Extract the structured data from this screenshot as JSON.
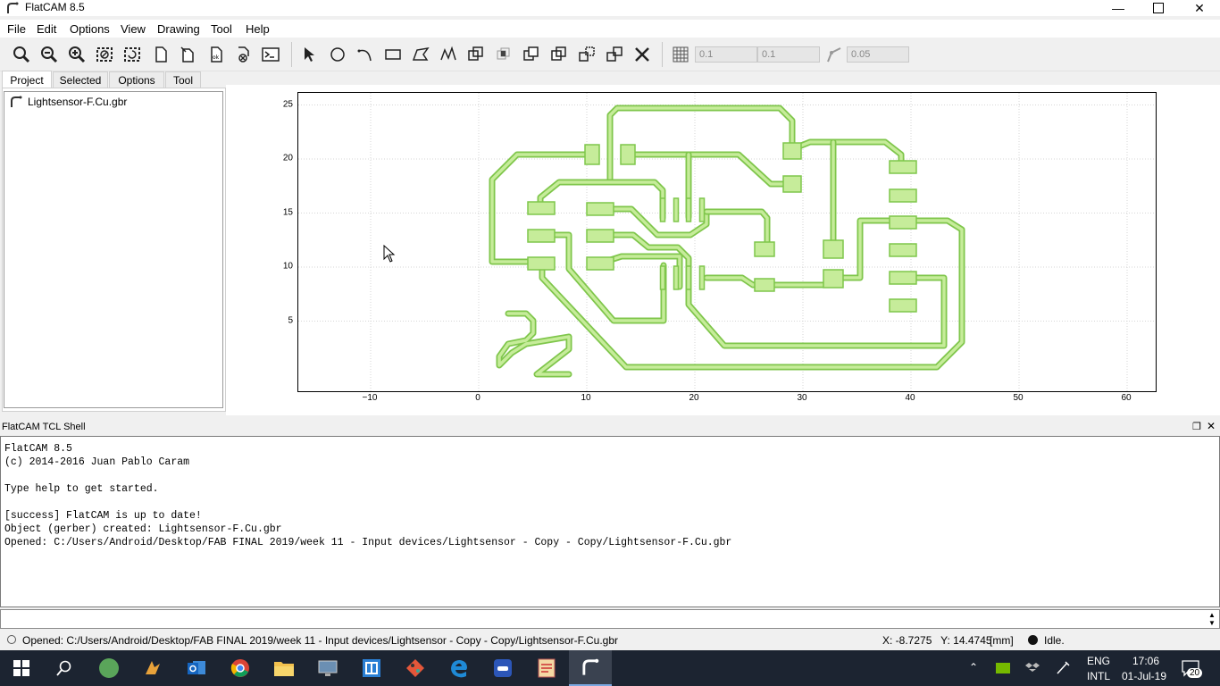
{
  "window": {
    "title": "FlatCAM 8.5"
  },
  "menu": [
    "File",
    "Edit",
    "Options",
    "View",
    "Drawing",
    "Tool",
    "Help"
  ],
  "toolbar": {
    "grid_x": "0.1",
    "grid_y": "0.1",
    "snap_max": "0.05"
  },
  "tabs": [
    "Project",
    "Selected",
    "Options",
    "Tool"
  ],
  "project": {
    "items": [
      "Lightsensor-F.Cu.gbr"
    ]
  },
  "plot": {
    "x_ticks": [
      "−10",
      "0",
      "10",
      "20",
      "30",
      "40",
      "50",
      "60"
    ],
    "y_ticks": [
      "25",
      "20",
      "15",
      "10",
      "5"
    ],
    "trace_color": "#7fc64b",
    "fill_color": "#c6ec9a"
  },
  "shell": {
    "title": "FlatCAM TCL Shell",
    "lines": [
      "FlatCAM 8.5",
      "(c) 2014-2016 Juan Pablo Caram",
      "",
      "Type help to get started.",
      "",
      "[success] FlatCAM is up to date!",
      "Object (gerber) created: Lightsensor-F.Cu.gbr",
      "Opened: C:/Users/Android/Desktop/FAB FINAL 2019/week 11 - Input devices/Lightsensor - Copy - Copy/Lightsensor-F.Cu.gbr"
    ]
  },
  "status": {
    "message": "Opened: C:/Users/Android/Desktop/FAB FINAL 2019/week 11 - Input devices/Lightsensor - Copy - Copy/Lightsensor-F.Cu.gbr",
    "coords": "X: -8.7275   Y: 14.4745",
    "units": "[mm]",
    "state": "Idle."
  },
  "taskbar": {
    "lang": "ENG",
    "layout": "INTL",
    "time": "17:06",
    "date": "01-Jul-19",
    "notifications": "20"
  }
}
